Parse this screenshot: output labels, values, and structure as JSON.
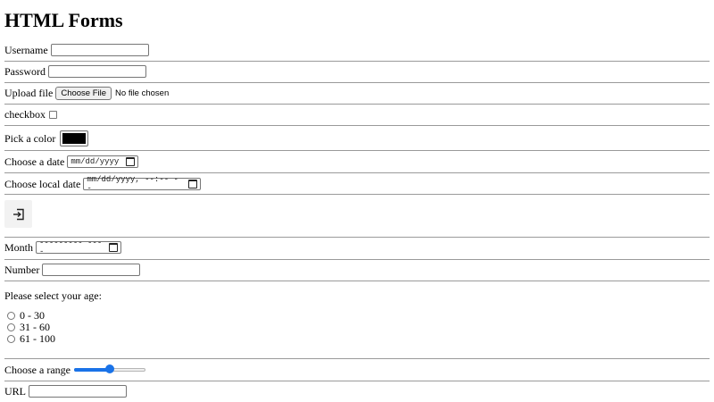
{
  "page": {
    "title": "HTML Forms"
  },
  "form": {
    "username": {
      "label": "Username",
      "value": ""
    },
    "password": {
      "label": "Password",
      "value": ""
    },
    "upload": {
      "label": "Upload file",
      "button": "Choose File",
      "status": "No file chosen"
    },
    "checkbox": {
      "label": "checkbox",
      "checked": false
    },
    "color": {
      "label": "Pick a color",
      "value": "#000000"
    },
    "date": {
      "label": "Choose a date",
      "placeholder": "mm/dd/yyyy"
    },
    "local_date": {
      "label": "Choose local date",
      "placeholder": "mm/dd/yyyy, --:-- --"
    },
    "image_button": {
      "icon": "login-icon"
    },
    "month": {
      "label": "Month",
      "placeholder": "--------- ----"
    },
    "number": {
      "label": "Number",
      "value": ""
    },
    "age": {
      "question": "Please select your age:",
      "options": [
        "0 - 30",
        "31 - 60",
        "61 - 100"
      ]
    },
    "range": {
      "label": "Choose a range",
      "value": 50,
      "min": 0,
      "max": 100
    },
    "url": {
      "label": "URL",
      "value": ""
    }
  },
  "colors": {
    "accent": "#1a73e8"
  }
}
